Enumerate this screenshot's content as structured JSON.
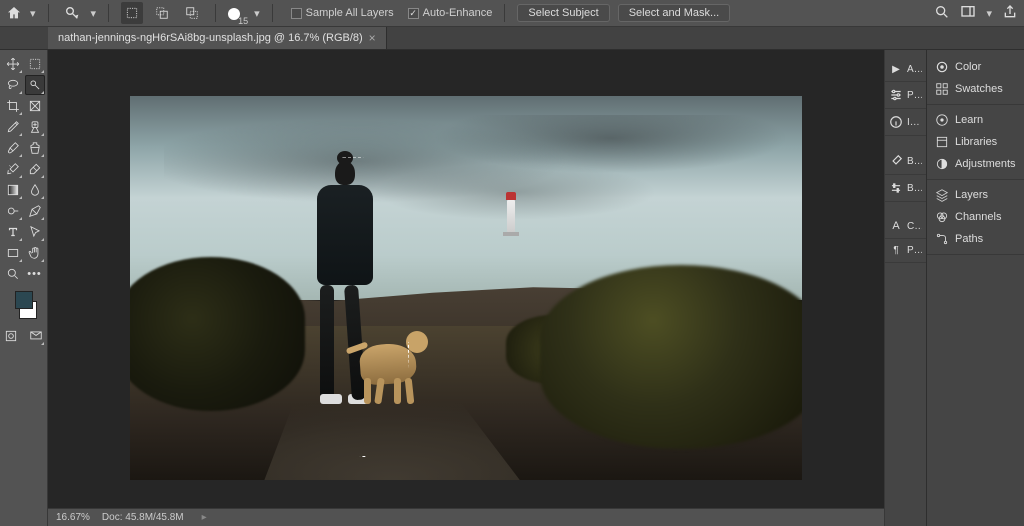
{
  "topbar": {
    "brush_size": "15",
    "sample_all_layers": "Sample All Layers",
    "sample_all_checked": false,
    "auto_enhance": "Auto-Enhance",
    "auto_enhance_checked": true,
    "select_subject": "Select Subject",
    "select_and_mask": "Select and Mask..."
  },
  "tab": {
    "title": "nathan-jennings-ngH6rSAi8bg-unsplash.jpg @ 16.7% (RGB/8)"
  },
  "right_strip": {
    "items": [
      {
        "label": "Ac...",
        "icon": "play"
      },
      {
        "label": "Pr...",
        "icon": "sliders"
      },
      {
        "label": "Info",
        "icon": "info"
      },
      {
        "label": "Br...",
        "icon": "brush"
      },
      {
        "label": "Br...",
        "icon": "adjust"
      },
      {
        "label": "Ch...",
        "icon": "char"
      },
      {
        "label": "Pa...",
        "icon": "para"
      }
    ]
  },
  "right_panel": {
    "color": "Color",
    "swatches": "Swatches",
    "learn": "Learn",
    "libraries": "Libraries",
    "adjustments": "Adjustments",
    "layers": "Layers",
    "channels": "Channels",
    "paths": "Paths"
  },
  "status": {
    "zoom": "16.67%",
    "doc": "Doc: 45.8M/45.8M"
  }
}
